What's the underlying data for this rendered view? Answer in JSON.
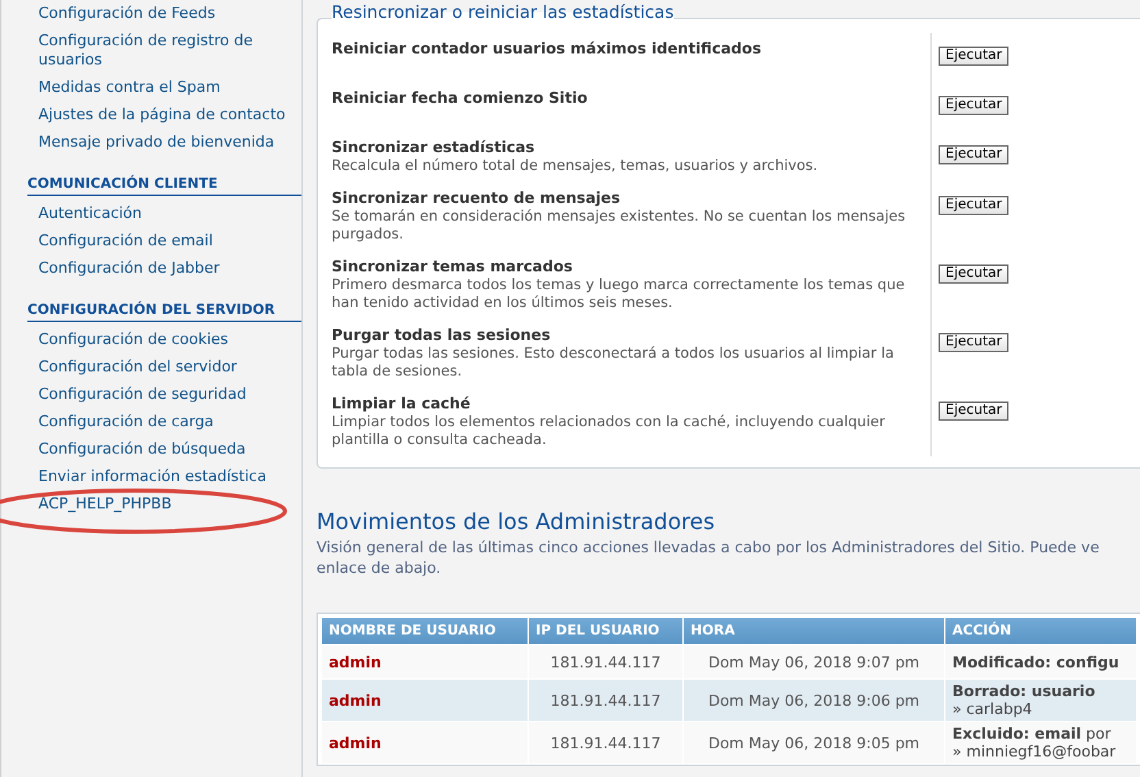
{
  "sidebar": {
    "sections": [
      {
        "items": [
          "Configuración de Feeds",
          "Configuración de registro de usuarios",
          "Medidas contra el Spam",
          "Ajustes de la página de contacto",
          "Mensaje privado de bienvenida"
        ]
      },
      {
        "heading": "COMUNICACIÓN CLIENTE",
        "items": [
          "Autenticación",
          "Configuración de email",
          "Configuración de Jabber"
        ]
      },
      {
        "heading": "CONFIGURACIÓN DEL SERVIDOR",
        "items": [
          "Configuración de cookies",
          "Configuración del servidor",
          "Configuración de seguridad",
          "Configuración de carga",
          "Configuración de búsqueda",
          "Enviar información estadística",
          "ACP_HELP_PHPBB"
        ]
      }
    ]
  },
  "stats_panel": {
    "legend": "Resincronizar o reiniciar las estadísticas",
    "rows": [
      {
        "title": "Reiniciar contador usuarios máximos identificados",
        "description": null,
        "button": "Ejecutar"
      },
      {
        "title": "Reiniciar fecha comienzo Sitio",
        "description": null,
        "button": "Ejecutar"
      },
      {
        "title": "Sincronizar estadísticas",
        "description": "Recalcula el número total de mensajes, temas, usuarios y archivos.",
        "button": "Ejecutar"
      },
      {
        "title": "Sincronizar recuento de mensajes",
        "description": "Se tomarán en consideración mensajes existentes. No se cuentan los mensajes purgados.",
        "button": "Ejecutar"
      },
      {
        "title": "Sincronizar temas marcados",
        "description": "Primero desmarca todos los temas y luego marca correctamente los temas que han tenido actividad en los últimos seis meses.",
        "button": "Ejecutar"
      },
      {
        "title": "Purgar todas las sesiones",
        "description": "Purgar todas las sesiones. Esto desconectará a todos los usuarios al limpiar la tabla de sesiones.",
        "button": "Ejecutar"
      },
      {
        "title": "Limpiar la caché",
        "description": "Limpiar todos los elementos relacionados con la caché, incluyendo cualquier plantilla o consulta cacheada.",
        "button": "Ejecutar"
      }
    ]
  },
  "admin_log": {
    "heading": "Movimientos de los Administradores",
    "description": "Visión general de las últimas cinco acciones llevadas a cabo por los Administradores del Sitio. Puede ve\nenlace de abajo.",
    "columns": [
      "NOMBRE DE USUARIO",
      "IP DEL USUARIO",
      "HORA",
      "ACCIÓN"
    ],
    "rows": [
      {
        "user": "admin",
        "ip": "181.91.44.117",
        "time": "Dom May 06, 2018 9:07 pm",
        "action": "**Modificado: configu**",
        "detail": null
      },
      {
        "user": "admin",
        "ip": "181.91.44.117",
        "time": "Dom May 06, 2018 9:06 pm",
        "action": "**Borrado: usuario**",
        "detail": "» carlabp4"
      },
      {
        "user": "admin",
        "ip": "181.91.44.117",
        "time": "Dom May 06, 2018 9:05 pm",
        "action": "**Excluido: email** por",
        "detail": "» minniegf16@foobar"
      }
    ]
  }
}
